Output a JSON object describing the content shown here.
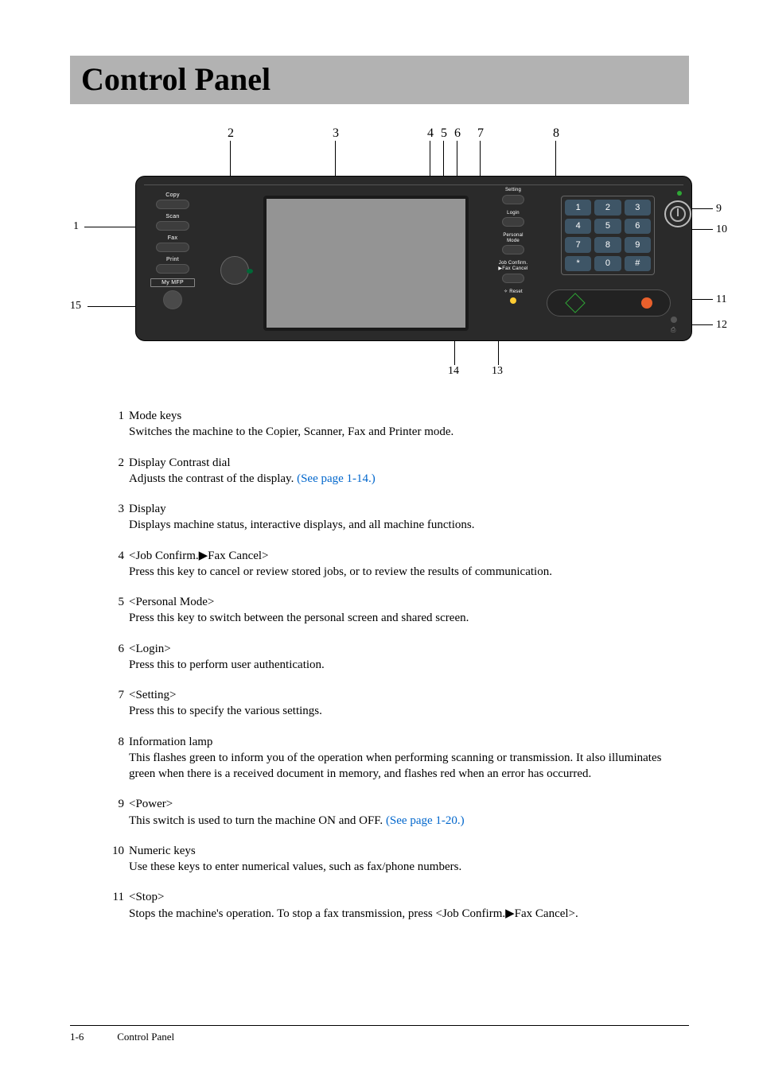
{
  "title": "Control Panel",
  "diagram": {
    "top_labels": [
      "2",
      "3",
      "4",
      "5",
      "6",
      "7",
      "8"
    ],
    "right_labels": [
      "9",
      "10",
      "11",
      "12"
    ],
    "bottom_labels": [
      "14",
      "13"
    ],
    "left_labels": [
      "1",
      "15"
    ],
    "panel": {
      "mode_keys": [
        "Copy",
        "Scan",
        "Fax",
        "Print",
        "My MFP"
      ],
      "right_buttons": [
        "Setting",
        "Login",
        "Personal\nMode",
        "Job Confirm.\n▶Fax Cancel",
        "✧ Reset"
      ],
      "keypad": [
        "1",
        "2",
        "3",
        "4",
        "5",
        "6",
        "7",
        "8",
        "9",
        "*",
        "0",
        "#"
      ],
      "print_glyph": "⎙"
    }
  },
  "items": [
    {
      "n": "1",
      "title": "Mode keys",
      "body": "Switches the machine to the Copier, Scanner, Fax and Printer mode."
    },
    {
      "n": "2",
      "title": "Display Contrast dial",
      "body": "Adjusts the contrast of the display. ",
      "link": "(See page 1-14.)"
    },
    {
      "n": "3",
      "title": "Display",
      "body": "Displays machine status, interactive displays, and all machine functions."
    },
    {
      "n": "4",
      "title": "<Job Confirm.▶Fax Cancel>",
      "body": "Press this key to cancel or review stored jobs, or to review the results of communication."
    },
    {
      "n": "5",
      "title": "<Personal Mode>",
      "body": "Press this key to switch between the personal screen and shared screen."
    },
    {
      "n": "6",
      "title": "<Login>",
      "body": "Press this to perform user authentication."
    },
    {
      "n": "7",
      "title": "<Setting>",
      "body": "Press this to specify the various settings."
    },
    {
      "n": "8",
      "title": "Information lamp",
      "body": "This flashes green to inform you of the operation when performing scanning or transmission. It also illuminates green when there is a received document in memory, and flashes red when an error has occurred."
    },
    {
      "n": "9",
      "title": "<Power>",
      "body": "This switch is used to turn the machine ON and OFF. ",
      "link": "(See page 1-20.)"
    },
    {
      "n": "10",
      "title": "Numeric keys",
      "body": "Use these keys to enter numerical values, such as fax/phone numbers."
    },
    {
      "n": "11",
      "title": "<Stop>",
      "body": "Stops the machine's operation. To stop a fax transmission, press <Job Confirm.▶Fax Cancel>."
    }
  ],
  "footer": {
    "page": "1-6",
    "section": "Control Panel"
  }
}
